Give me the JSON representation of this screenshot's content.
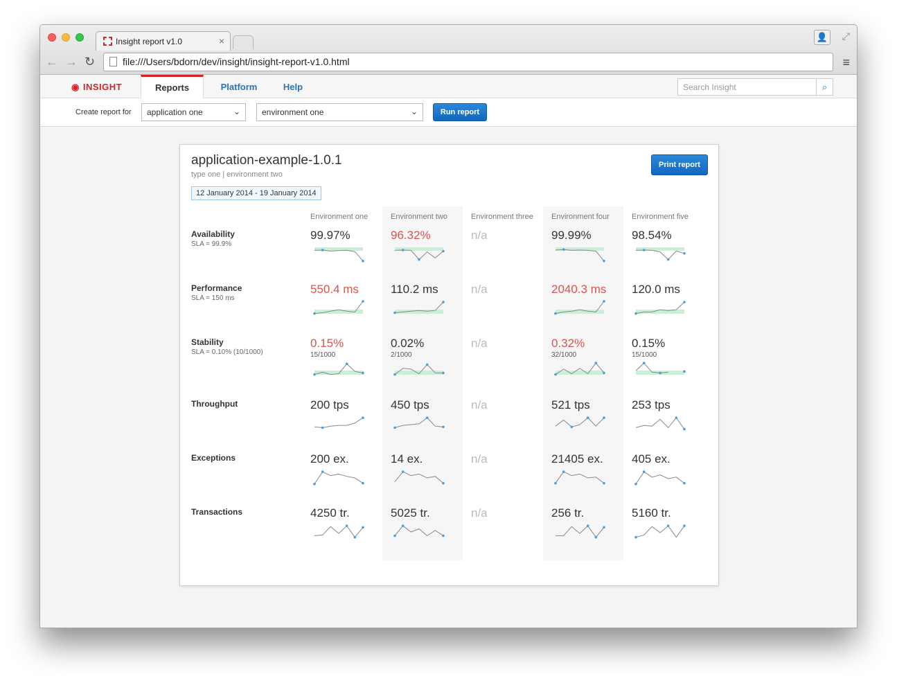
{
  "browser": {
    "tab_title": "Insight report v1.0",
    "tab_close": "×",
    "url": "file:///Users/bdorn/dev/insight/insight-report-v1.0.html",
    "back_icon": "←",
    "forward_icon": "→",
    "reload_icon": "↻",
    "menu_icon": "≡",
    "profile_icon": "👤",
    "fullscreen_icon": "⤢"
  },
  "header": {
    "logo": "INSIGHT",
    "logo_icon": "◉",
    "tabs": [
      "Reports",
      "Platform",
      "Help"
    ],
    "search_placeholder": "Search Insight",
    "search_icon": "⌕"
  },
  "toolbar": {
    "label": "Create report for",
    "application": "application one",
    "environment": "environment one",
    "chevron": "⌄",
    "run_label": "Run report"
  },
  "report": {
    "title": "application-example-1.0.1",
    "subtitle": "type one | environment two",
    "date_range": "12 January 2014 - 19 January 2014",
    "print_label": "Print report",
    "columns": [
      "Environment one",
      "Environment two",
      "Environment three",
      "Environment four",
      "Environment five"
    ],
    "metrics": [
      {
        "name": "Availability",
        "sla": "SLA = 99.9%"
      },
      {
        "name": "Performance",
        "sla": "SLA = 150 ms"
      },
      {
        "name": "Stability",
        "sla": "SLA = 0.10% (10/1000)"
      },
      {
        "name": "Throughput",
        "sla": ""
      },
      {
        "name": "Exceptions",
        "sla": ""
      },
      {
        "name": "Transactions",
        "sla": ""
      }
    ],
    "cells": [
      [
        {
          "value": "99.97%",
          "status": "ok",
          "sub": ""
        },
        {
          "value": "96.32%",
          "status": "bad",
          "sub": ""
        },
        {
          "value": "n/a",
          "status": "na",
          "sub": ""
        },
        {
          "value": "99.99%",
          "status": "ok",
          "sub": ""
        },
        {
          "value": "98.54%",
          "status": "ok",
          "sub": ""
        }
      ],
      [
        {
          "value": "550.4 ms",
          "status": "bad",
          "sub": ""
        },
        {
          "value": "110.2 ms",
          "status": "ok",
          "sub": ""
        },
        {
          "value": "n/a",
          "status": "na",
          "sub": ""
        },
        {
          "value": "2040.3 ms",
          "status": "bad",
          "sub": ""
        },
        {
          "value": "120.0 ms",
          "status": "ok",
          "sub": ""
        }
      ],
      [
        {
          "value": "0.15%",
          "status": "bad",
          "sub": "15/1000"
        },
        {
          "value": "0.02%",
          "status": "ok",
          "sub": "2/1000"
        },
        {
          "value": "n/a",
          "status": "na",
          "sub": ""
        },
        {
          "value": "0.32%",
          "status": "bad",
          "sub": "32/1000"
        },
        {
          "value": "0.15%",
          "status": "ok",
          "sub": "15/1000"
        }
      ],
      [
        {
          "value": "200 tps",
          "status": "ok",
          "sub": ""
        },
        {
          "value": "450 tps",
          "status": "ok",
          "sub": ""
        },
        {
          "value": "n/a",
          "status": "na",
          "sub": ""
        },
        {
          "value": "521 tps",
          "status": "ok",
          "sub": ""
        },
        {
          "value": "253 tps",
          "status": "ok",
          "sub": ""
        }
      ],
      [
        {
          "value": "200 ex.",
          "status": "ok",
          "sub": ""
        },
        {
          "value": "14 ex.",
          "status": "ok",
          "sub": ""
        },
        {
          "value": "n/a",
          "status": "na",
          "sub": ""
        },
        {
          "value": "21405 ex.",
          "status": "ok",
          "sub": ""
        },
        {
          "value": "405 ex.",
          "status": "ok",
          "sub": ""
        }
      ],
      [
        {
          "value": "4250 tr.",
          "status": "ok",
          "sub": ""
        },
        {
          "value": "5025 tr.",
          "status": "ok",
          "sub": ""
        },
        {
          "value": "n/a",
          "status": "na",
          "sub": ""
        },
        {
          "value": "256 tr.",
          "status": "ok",
          "sub": ""
        },
        {
          "value": "5160 tr.",
          "status": "ok",
          "sub": ""
        }
      ]
    ],
    "colors": {
      "bad": "#d9534f",
      "na": "#bbbbbb",
      "spark_line": "#888888",
      "spark_dot": "#4a9fd8",
      "sla_band": "#c9efd8",
      "accent": "#d42424",
      "link": "#2a73b8"
    },
    "sparklines": [
      [
        [
          0.8,
          0.82,
          0.75,
          0.78,
          0.8,
          0.72,
          0.1
        ],
        [
          0.8,
          0.82,
          0.8,
          0.2,
          0.7,
          0.3,
          0.75
        ],
        null,
        [
          0.82,
          0.85,
          0.8,
          0.82,
          0.8,
          0.75,
          0.1
        ],
        [
          0.8,
          0.82,
          0.8,
          0.7,
          0.2,
          0.75,
          0.6
        ]
      ],
      [
        [
          0.2,
          0.25,
          0.35,
          0.45,
          0.35,
          0.3,
          1.0
        ],
        [
          0.25,
          0.3,
          0.35,
          0.4,
          0.35,
          0.4,
          0.95
        ],
        null,
        [
          0.2,
          0.3,
          0.35,
          0.45,
          0.35,
          0.3,
          1.0
        ],
        [
          0.2,
          0.3,
          0.3,
          0.45,
          0.4,
          0.45,
          0.95
        ]
      ],
      [
        [
          0.2,
          0.35,
          0.2,
          0.25,
          0.9,
          0.4,
          0.3
        ],
        [
          0.2,
          0.6,
          0.55,
          0.25,
          0.85,
          0.3,
          0.3
        ],
        null,
        [
          0.2,
          0.55,
          0.25,
          0.6,
          0.25,
          0.95,
          0.3
        ],
        [
          0.45,
          0.95,
          0.35,
          0.3,
          0.35,
          null,
          0.4
        ]
      ],
      [
        [
          0.35,
          0.3,
          0.4,
          0.45,
          0.45,
          0.6,
          0.95
        ],
        [
          0.3,
          0.45,
          0.5,
          0.55,
          0.95,
          0.4,
          0.35
        ],
        null,
        [
          0.4,
          0.8,
          0.35,
          0.5,
          0.95,
          0.4,
          0.95
        ],
        [
          0.3,
          0.45,
          0.4,
          0.85,
          0.3,
          0.95,
          0.2
        ]
      ],
      [
        [
          0.15,
          0.95,
          0.7,
          0.8,
          0.65,
          0.55,
          0.2
        ],
        [
          0.3,
          0.95,
          0.7,
          0.8,
          0.55,
          0.65,
          0.2
        ],
        null,
        [
          0.2,
          0.95,
          0.7,
          0.8,
          0.55,
          0.6,
          0.2
        ],
        [
          0.15,
          0.95,
          0.6,
          0.75,
          0.5,
          0.6,
          0.2
        ]
      ],
      [
        [
          0.3,
          0.35,
          0.9,
          0.45,
          0.95,
          0.2,
          0.85
        ],
        [
          0.3,
          0.95,
          0.55,
          0.75,
          0.3,
          0.65,
          0.3
        ],
        null,
        [
          0.3,
          0.3,
          0.9,
          0.45,
          0.95,
          0.2,
          0.85
        ],
        [
          0.2,
          0.35,
          0.9,
          0.5,
          0.95,
          0.2,
          0.95
        ]
      ]
    ]
  }
}
